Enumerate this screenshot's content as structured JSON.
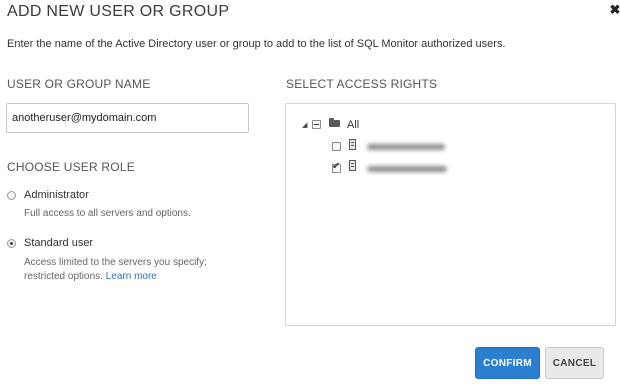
{
  "dialog": {
    "title": "ADD NEW USER OR GROUP",
    "close_glyph": "✖",
    "intro": "Enter the name of the Active Directory user or group to add to the list of SQL Monitor authorized users."
  },
  "user_name": {
    "heading": "USER OR GROUP NAME",
    "value": "anotheruser@mydomain.com"
  },
  "role": {
    "heading": "CHOOSE USER ROLE",
    "options": [
      {
        "label": "Administrator",
        "description": "Full access to all servers and options.",
        "selected": false
      },
      {
        "label": "Standard user",
        "description": "Access limited to the servers you specify; restricted options.",
        "link": "Learn more",
        "selected": true
      }
    ]
  },
  "access": {
    "heading": "SELECT ACCESS RIGHTS",
    "tree": {
      "expander_glyph": "◢",
      "root_label": "All",
      "root_state": "partial",
      "children": [
        {
          "icon": "server-icon",
          "checked": false
        },
        {
          "icon": "server-icon",
          "checked": true,
          "check_glyph": "✔"
        }
      ]
    }
  },
  "buttons": {
    "confirm": "CONFIRM",
    "cancel": "CANCEL"
  },
  "colors": {
    "accent": "#2b7fd0",
    "link": "#2c73c4"
  }
}
